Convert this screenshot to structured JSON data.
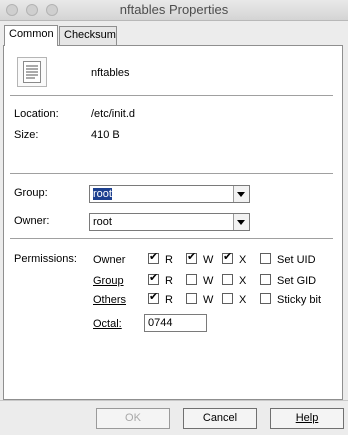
{
  "window": {
    "title": "nftables Properties"
  },
  "tabs": [
    {
      "label": "Common"
    },
    {
      "label": "Checksum"
    }
  ],
  "file": {
    "name": "nftables",
    "icon": "document-icon",
    "location_label": "Location:",
    "location_value": "/etc/init.d",
    "size_label": "Size:",
    "size_value": "410 B"
  },
  "group": {
    "label": "Group:",
    "value": "root"
  },
  "owner": {
    "label": "Owner:",
    "value": "root"
  },
  "permissions": {
    "label": "Permissions:",
    "rows": [
      {
        "label": "Owner",
        "r": true,
        "w": true,
        "x": true,
        "special_label": "Set UID",
        "special": false
      },
      {
        "label": "Group",
        "r": true,
        "w": false,
        "x": false,
        "special_label": "Set GID",
        "special": false
      },
      {
        "label": "Others",
        "r": true,
        "w": false,
        "x": false,
        "special_label": "Sticky bit",
        "special": false
      }
    ],
    "r_label": "R",
    "w_label": "W",
    "x_label": "X",
    "octal_label": "Octal:",
    "octal_value": "0744"
  },
  "buttons": {
    "ok": "OK",
    "cancel": "Cancel",
    "help": "Help"
  }
}
